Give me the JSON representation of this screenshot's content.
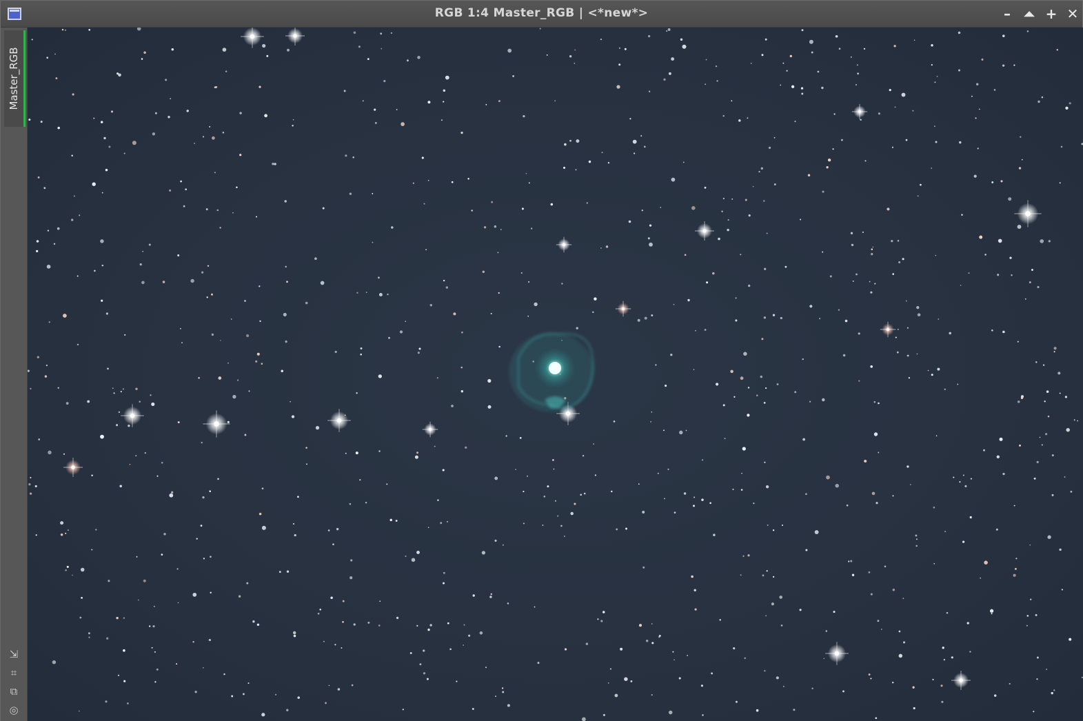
{
  "window": {
    "title": "RGB 1:4 Master_RGB | <*new*>",
    "buttons": {
      "minimize": "–",
      "shade": "⏶",
      "maximize": "+",
      "close": "✕"
    }
  },
  "view_tab": {
    "label": "Master_RGB",
    "accent_color": "#2fb24a"
  },
  "side_tools": {
    "icons": [
      "resize-icon",
      "crop-icon",
      "clone-icon",
      "target-icon"
    ],
    "glyphs": [
      "⇲",
      "⌗",
      "⧉",
      "◎"
    ]
  },
  "image": {
    "subject": "star field with central planetary nebula",
    "background_color": "#28323f",
    "nebula_color": "#3fb8b0"
  }
}
